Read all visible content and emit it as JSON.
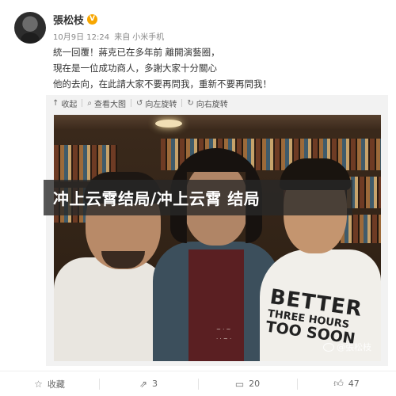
{
  "post": {
    "username": "張松枝",
    "verified_badge": "V",
    "date": "10月9日 12:24",
    "source_prefix": "来自",
    "source": "小米手机",
    "lines": [
      "統一回覆！蔣克已在多年前 離開演藝圈，",
      "現在是一位成功商人，多謝大家十分關心",
      "他的去向，在此請大家不要再問我，重新不要再問我！"
    ]
  },
  "toolbar": {
    "collapse": "收起",
    "view_large": "查看大图",
    "rotate_left": "向左旋转",
    "rotate_right": "向右旋转"
  },
  "photo": {
    "shirt_line1": "BETTER",
    "shirt_line2": "THREE HOURS",
    "shirt_line3": "TOO SOON",
    "watermark": "@張松枝"
  },
  "banner": {
    "text": "冲上云霄结局/冲上云霄 结局"
  },
  "actions": {
    "favorite": "收藏",
    "repost_count": "3",
    "comment_count": "20",
    "like_count": "47"
  },
  "colors": {
    "verified": "#f7a600",
    "toolbar_bg": "#f2f2f2",
    "banner_bg": "#282828"
  }
}
